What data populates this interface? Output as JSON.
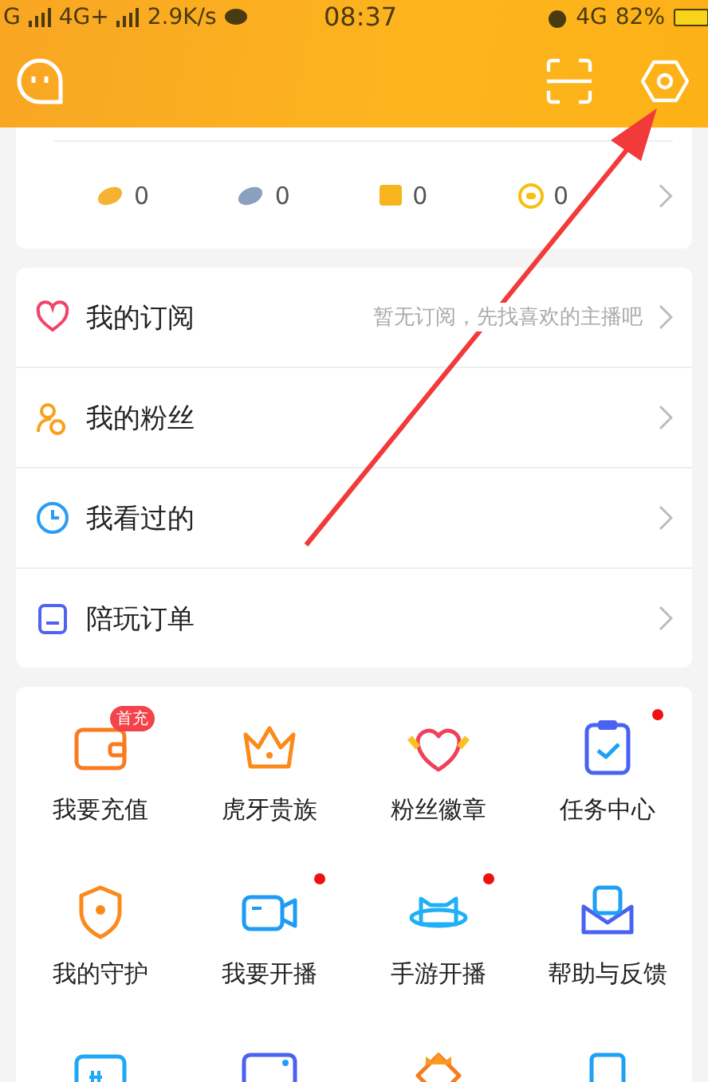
{
  "status_bar": {
    "left": [
      "G",
      "4G+"
    ],
    "speed": "2.9K/s",
    "time": "08:37",
    "network": "4G",
    "battery": "82%"
  },
  "currency": [
    {
      "value": "0"
    },
    {
      "value": "0"
    },
    {
      "value": "0"
    },
    {
      "value": "0"
    }
  ],
  "menu": [
    {
      "label": "我的订阅",
      "hint": "暂无订阅，先找喜欢的主播吧"
    },
    {
      "label": "我的粉丝"
    },
    {
      "label": "我看过的"
    },
    {
      "label": "陪玩订单"
    }
  ],
  "grid": [
    {
      "label": "我要充值",
      "badge": "首充",
      "dot": false
    },
    {
      "label": "虎牙贵族",
      "dot": false
    },
    {
      "label": "粉丝徽章",
      "dot": false
    },
    {
      "label": "任务中心",
      "dot": true
    },
    {
      "label": "我的守护",
      "dot": false
    },
    {
      "label": "我要开播",
      "dot": true
    },
    {
      "label": "手游开播",
      "dot": true
    },
    {
      "label": "帮助与反馈",
      "dot": false
    },
    {
      "dot": false
    },
    {
      "dot": false
    },
    {
      "dot": false
    },
    {
      "dot": false
    }
  ]
}
